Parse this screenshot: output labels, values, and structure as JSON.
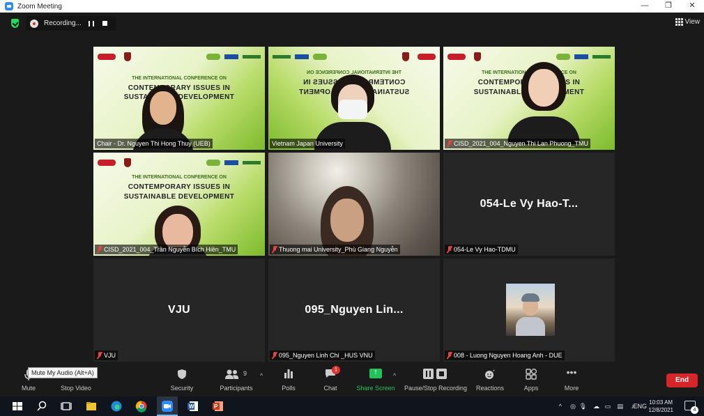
{
  "window": {
    "title": "Zoom Meeting",
    "minimize": "—",
    "restore": "❐",
    "close": "✕"
  },
  "topbar": {
    "recording_label": "Recording...",
    "view_label": "View"
  },
  "conference_banner": {
    "line1": "THE INTERNATIONAL CONFERENCE ON",
    "line2": "CONTEMPORARY ISSUES IN",
    "line3": "SUSTAINABLE DEVELOPMENT"
  },
  "participants": [
    {
      "name": "Chair - Dr. Nguyen Thi Hong Thuy (UEB)",
      "muted": false
    },
    {
      "name": "Vietnam Japan University",
      "muted": false,
      "active": true
    },
    {
      "name": "CISD_2021_004_Nguyen Thi Lan Phuong_TMU",
      "muted": true
    },
    {
      "name": "CISD_2021_004_Trần Nguyễn Bích Hiền_TMU",
      "muted": true
    },
    {
      "name": "Thuong mai University_Phù Giang Nguyễn",
      "muted": true
    },
    {
      "name": "054-Le Vy Hao-TDMU",
      "muted": true,
      "display": "054-Le Vy Hao-T..."
    },
    {
      "name": "VJU",
      "muted": true,
      "display": "VJU"
    },
    {
      "name": "095_Nguyen Linh Chi _HUS VNU",
      "muted": true,
      "display": "095_Nguyen  Lin..."
    },
    {
      "name": "008 - Luong Nguyen Hoang Anh - DUE",
      "muted": true
    }
  ],
  "toolbar": {
    "tooltip": "Mute My Audio (Alt+A)",
    "mute": "Mute",
    "stop_video": "Stop Video",
    "security": "Security",
    "participants": "Participants",
    "participants_count": "9",
    "polls": "Polls",
    "chat": "Chat",
    "chat_badge": "1",
    "share_screen": "Share Screen",
    "pause_stop_recording": "Pause/Stop Recording",
    "reactions": "Reactions",
    "apps": "Apps",
    "more": "More",
    "end": "End"
  },
  "taskbar": {
    "lang": "ENG",
    "time": "10:03 AM",
    "date": "12/8/2021",
    "notifications": "4"
  },
  "colors": {
    "active_speaker": "#e7ee52",
    "share_green": "#23c35b",
    "end_red": "#d7262a",
    "muted_red": "#e84242"
  }
}
